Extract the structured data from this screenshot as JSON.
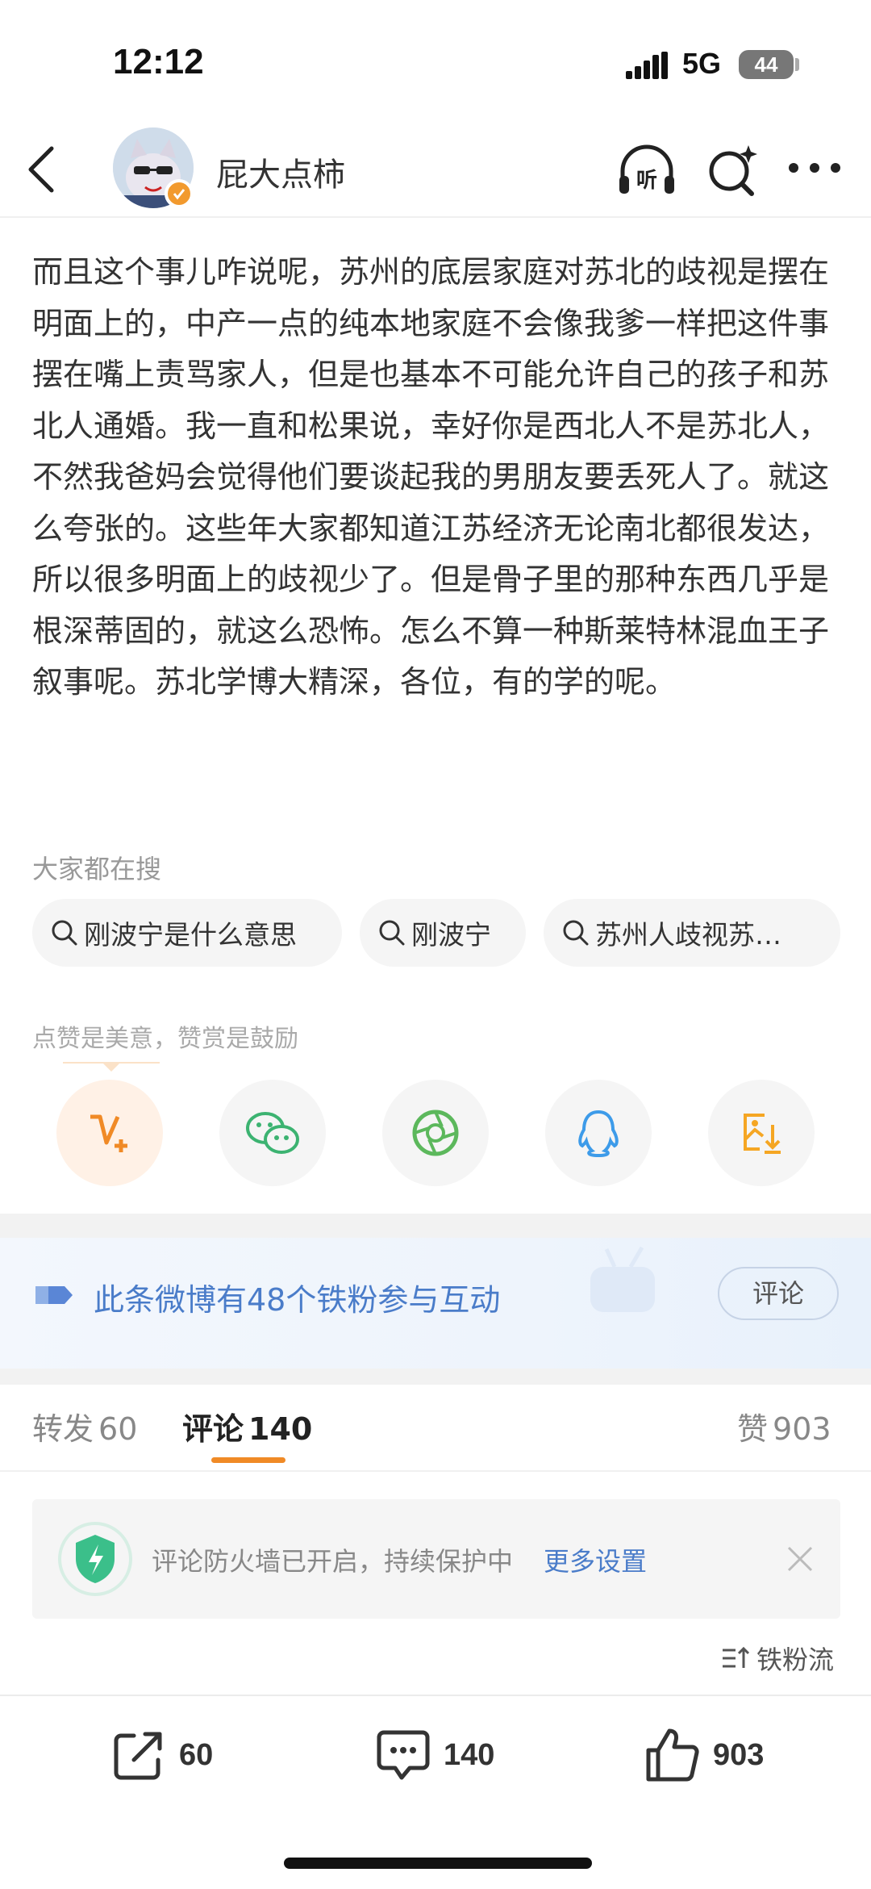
{
  "status_bar": {
    "time": "12:12",
    "network": "5G",
    "battery": "44"
  },
  "header": {
    "username": "屁大点柿",
    "listen_icon_text": "听"
  },
  "post": {
    "text": "而且这个事儿咋说呢，苏州的底层家庭对苏北的歧视是摆在明面上的，中产一点的纯本地家庭不会像我爹一样把这件事摆在嘴上责骂家人，但是也基本不可能允许自己的孩子和苏北人通婚。我一直和松果说，幸好你是西北人不是苏北人，不然我爸妈会觉得他们要谈起我的男朋友要丢死人了。就这么夸张的。这些年大家都知道江苏经济无论南北都很发达，所以很多明面上的歧视少了。但是骨子里的那种东西几乎是根深蒂固的，就这么恐怖。怎么不算一种斯莱特林混血王子叙事呢。苏北学博大精深，各位，有的学的呢。"
  },
  "search": {
    "title": "大家都在搜",
    "chips": [
      "刚波宁是什么意思",
      "刚波宁",
      "苏州人歧视苏…"
    ]
  },
  "reward": {
    "title": "点赞是美意，赞赏是鼓励",
    "share_icons": [
      "reward-v-plus-icon",
      "wechat-icon",
      "moments-icon",
      "qq-icon",
      "save-image-icon"
    ]
  },
  "fans_banner": {
    "text": "此条微博有48个铁粉参与互动",
    "button": "评论"
  },
  "tabs": {
    "repost_label": "转发",
    "repost_count": "60",
    "comment_label": "评论",
    "comment_count": "140",
    "like_label": "赞",
    "like_count": "903"
  },
  "firewall": {
    "text": "评论防火墙已开启，持续保护中",
    "link": "更多设置"
  },
  "sort_label": "铁粉流",
  "bottom_bar": {
    "repost_count": "60",
    "comment_count": "140",
    "like_count": "903"
  },
  "colors": {
    "accent_orange": "#f08a26",
    "link_blue": "#4a7cc9",
    "verified_orange": "#f29a2e"
  }
}
